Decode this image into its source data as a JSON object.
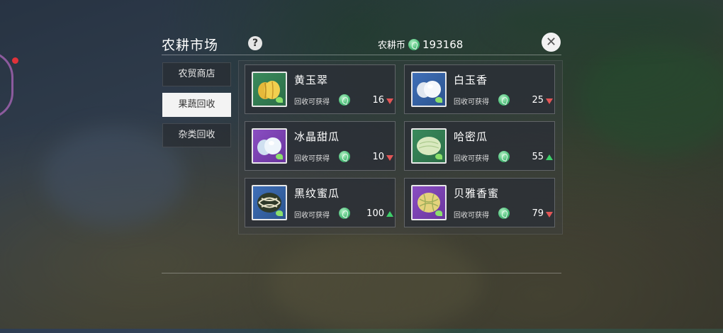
{
  "header": {
    "title": "农耕市场",
    "help_label": "?",
    "currency_label": "农耕币",
    "currency_amount": "193168",
    "close_label": "✕"
  },
  "tabs": [
    {
      "label": "农贸商店",
      "active": false
    },
    {
      "label": "果蔬回收",
      "active": true
    },
    {
      "label": "杂类回收",
      "active": false
    }
  ],
  "recycle_label": "回收可获得",
  "items": [
    {
      "name": "黄玉翠",
      "price": "16",
      "trend": "down",
      "bg": "green",
      "fruit": "yellow-melon"
    },
    {
      "name": "白玉香",
      "price": "25",
      "trend": "down",
      "bg": "blue",
      "fruit": "white-melon"
    },
    {
      "name": "冰晶甜瓜",
      "price": "10",
      "trend": "down",
      "bg": "purple",
      "fruit": "ice-melon"
    },
    {
      "name": "哈密瓜",
      "price": "55",
      "trend": "up",
      "bg": "green",
      "fruit": "hami-melon"
    },
    {
      "name": "黑纹蜜瓜",
      "price": "100",
      "trend": "up",
      "bg": "blue",
      "fruit": "striped-melon"
    },
    {
      "name": "贝雅香蜜",
      "price": "79",
      "trend": "down",
      "bg": "purple",
      "fruit": "netted-melon"
    }
  ],
  "colors": {
    "trend_up": "#3ecf6a",
    "trend_down": "#e35656",
    "coin": "#4fc07b"
  }
}
